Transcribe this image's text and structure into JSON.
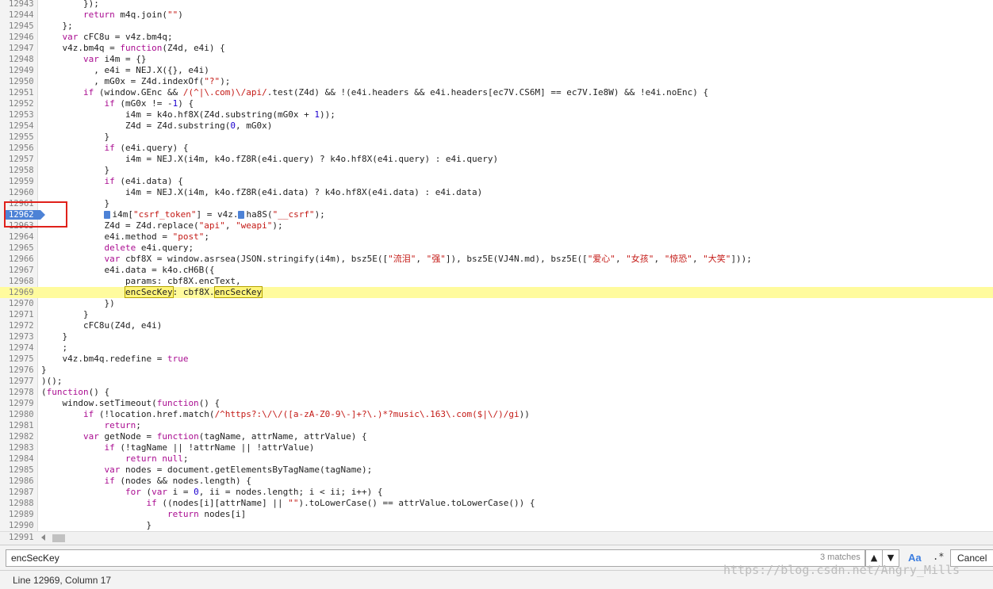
{
  "editor": {
    "lines": [
      {
        "n": "12943",
        "t": "        });"
      },
      {
        "n": "12944",
        "h": "        <span class=\"kw\">return</span> m4q.join(<span class=\"str\">\"\"</span>)"
      },
      {
        "n": "12945",
        "t": "    };"
      },
      {
        "n": "12946",
        "h": "    <span class=\"kw\">var</span> cFC8u = v4z.bm4q;"
      },
      {
        "n": "12947",
        "h": "    v4z.bm4q = <span class=\"kw\">function</span>(Z4d, e4i) {"
      },
      {
        "n": "12948",
        "h": "        <span class=\"kw\">var</span> i4m = {}"
      },
      {
        "n": "12949",
        "t": "          , e4i = NEJ.X({}, e4i)"
      },
      {
        "n": "12950",
        "h": "          , mG0x = Z4d.indexOf(<span class=\"str\">\"?\"</span>);"
      },
      {
        "n": "12951",
        "h": "        <span class=\"kw\">if</span> (window.GEnc && <span class=\"re\">/(^|\\.com)\\/api/</span>.test(Z4d) && !(e4i.headers && e4i.headers[ec7V.CS6M] == ec7V.Ie8W) && !e4i.noEnc) {"
      },
      {
        "n": "12952",
        "h": "            <span class=\"kw\">if</span> (mG0x != -<span class=\"num\">1</span>) {"
      },
      {
        "n": "12953",
        "h": "                i4m = k4o.hf8X(Z4d.substring(mG0x + <span class=\"num\">1</span>));"
      },
      {
        "n": "12954",
        "h": "                Z4d = Z4d.substring(<span class=\"num\">0</span>, mG0x)"
      },
      {
        "n": "12955",
        "t": "            }"
      },
      {
        "n": "12956",
        "h": "            <span class=\"kw\">if</span> (e4i.query) {"
      },
      {
        "n": "12957",
        "t": "                i4m = NEJ.X(i4m, k4o.fZ8R(e4i.query) ? k4o.hf8X(e4i.query) : e4i.query)"
      },
      {
        "n": "12958",
        "t": "            }"
      },
      {
        "n": "12959",
        "h": "            <span class=\"kw\">if</span> (e4i.data) {"
      },
      {
        "n": "12960",
        "t": "                i4m = NEJ.X(i4m, k4o.fZ8R(e4i.data) ? k4o.hf8X(e4i.data) : e4i.data)"
      },
      {
        "n": "12961",
        "t": "            }"
      },
      {
        "n": "12962",
        "bp": true,
        "h": "            <span class=\"pause-mark\"></span>i4m[<span class=\"str\">\"csrf_token\"</span>] = v4z.<span class=\"pause-mark\"></span>ha8S(<span class=\"str\">\"__csrf\"</span>);"
      },
      {
        "n": "12963",
        "h": "            Z4d = Z4d.replace(<span class=\"str\">\"api\"</span>, <span class=\"str\">\"weapi\"</span>);"
      },
      {
        "n": "12964",
        "h": "            e4i.method = <span class=\"str\">\"post\"</span>;"
      },
      {
        "n": "12965",
        "h": "            <span class=\"kw\">delete</span> e4i.query;"
      },
      {
        "n": "12966",
        "h": "            <span class=\"kw\">var</span> cbf8X = window.asrsea(JSON.stringify(i4m), bsz5E([<span class=\"str\">\"流泪\"</span>, <span class=\"str\">\"强\"</span>]), bsz5E(VJ4N.md), bsz5E([<span class=\"str\">\"爱心\"</span>, <span class=\"str\">\"女孩\"</span>, <span class=\"str\">\"惊恐\"</span>, <span class=\"str\">\"大笑\"</span>]));"
      },
      {
        "n": "12967",
        "t": "            e4i.data = k4o.cH6B({"
      },
      {
        "n": "12968",
        "t": "                params: cbf8X.encText,"
      },
      {
        "n": "12969",
        "exec": true,
        "h": "                <span class=\"hl\">encSecKey</span>: cbf8X.<span class=\"hl\">encSecKey</span>"
      },
      {
        "n": "12970",
        "t": "            })"
      },
      {
        "n": "12971",
        "t": "        }"
      },
      {
        "n": "12972",
        "t": "        cFC8u(Z4d, e4i)"
      },
      {
        "n": "12973",
        "t": "    }"
      },
      {
        "n": "12974",
        "t": "    ;"
      },
      {
        "n": "12975",
        "h": "    v4z.bm4q.redefine = <span class=\"kw\">true</span>"
      },
      {
        "n": "12976",
        "t": "}"
      },
      {
        "n": "12977",
        "t": ")();"
      },
      {
        "n": "12978",
        "h": "(<span class=\"kw\">function</span>() {"
      },
      {
        "n": "12979",
        "h": "    window.setTimeout(<span class=\"kw\">function</span>() {"
      },
      {
        "n": "12980",
        "h": "        <span class=\"kw\">if</span> (!location.href.match(<span class=\"re\">/^https?:\\/\\/([a-zA-Z0-9\\-]+?\\.)*?music\\.163\\.com($|\\/)/gi</span>))"
      },
      {
        "n": "12981",
        "h": "            <span class=\"kw\">return</span>;"
      },
      {
        "n": "12982",
        "h": "        <span class=\"kw\">var</span> getNode = <span class=\"kw\">function</span>(tagName, attrName, attrValue) {"
      },
      {
        "n": "12983",
        "h": "            <span class=\"kw\">if</span> (!tagName || !attrName || !attrValue)"
      },
      {
        "n": "12984",
        "h": "                <span class=\"kw\">return</span> <span class=\"kw\">null</span>;"
      },
      {
        "n": "12985",
        "h": "            <span class=\"kw\">var</span> nodes = document.getElementsByTagName(tagName);"
      },
      {
        "n": "12986",
        "h": "            <span class=\"kw\">if</span> (nodes && nodes.length) {"
      },
      {
        "n": "12987",
        "h": "                <span class=\"kw\">for</span> (<span class=\"kw\">var</span> i = <span class=\"num\">0</span>, ii = nodes.length; i < ii; i++) {"
      },
      {
        "n": "12988",
        "h": "                    <span class=\"kw\">if</span> ((nodes[i][attrName] || <span class=\"str\">\"\"</span>).toLowerCase() == attrValue.toLowerCase()) {"
      },
      {
        "n": "12989",
        "h": "                        <span class=\"kw\">return</span> nodes[i]"
      },
      {
        "n": "12990",
        "t": "                    }"
      }
    ],
    "scroll_line": "12991"
  },
  "search": {
    "value": "encSecKey",
    "match_count": "3 matches",
    "prev_label": "▲",
    "next_label": "▼",
    "case_label": "Aa",
    "regex_label": ".*",
    "cancel_label": "Cancel"
  },
  "status": {
    "position": "Line 12969, Column 17"
  },
  "watermark": "https://blog.csdn.net/Angry_Mills",
  "colors": {
    "breakpoint": "#4d82d6",
    "exec_line": "#fffb9d",
    "keyword": "#aa0d91",
    "string": "#c41a16",
    "annotation_box": "#e0211b"
  }
}
